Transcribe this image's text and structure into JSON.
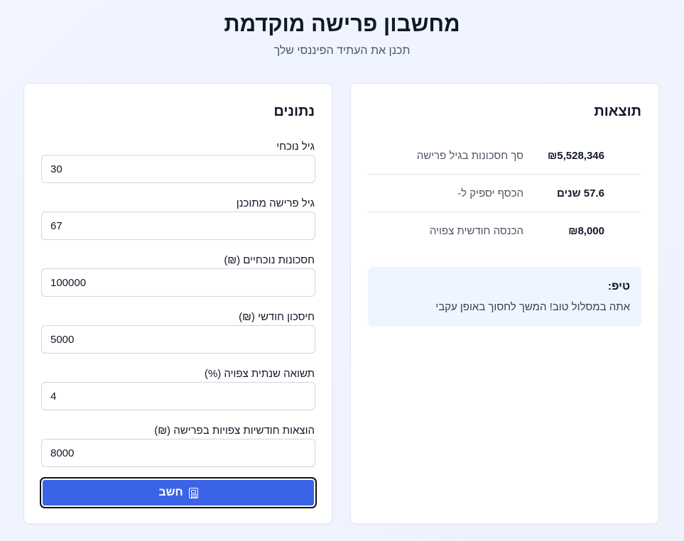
{
  "header": {
    "title": "מחשבון פרישה מוקדמת",
    "subtitle": "תכנן את העתיד הפיננסי שלך"
  },
  "inputs_card": {
    "title": "נתונים",
    "fields": [
      {
        "label": "גיל נוכחי",
        "value": "30"
      },
      {
        "label": "גיל פרישה מתוכנן",
        "value": "67"
      },
      {
        "label": "חסכונות נוכחיים (₪)",
        "value": "100000"
      },
      {
        "label": "חיסכון חודשי (₪)",
        "value": "5000"
      },
      {
        "label": "תשואה שנתית צפויה (%)",
        "value": "4"
      },
      {
        "label": "הוצאות חודשיות צפויות בפרישה (₪)",
        "value": "8000"
      }
    ],
    "calculate_label": "חשב",
    "calculate_icon": "calculator-icon"
  },
  "results_card": {
    "title": "תוצאות",
    "rows": [
      {
        "label": "סך חסכונות בגיל פרישה",
        "value": "₪5,528,346"
      },
      {
        "label": "הכסף יספיק ל-",
        "value": "57.6 שנים"
      },
      {
        "label": "הכנסה חודשית צפויה",
        "value": "₪8,000"
      }
    ],
    "tip": {
      "title": "טיפ:",
      "text": "אתה במסלול טוב! המשך לחסוך באופן עקבי"
    }
  },
  "colors": {
    "accent": "#3b63e8",
    "tip_background": "#eff5ff",
    "page_background": "#f0f5ff"
  }
}
